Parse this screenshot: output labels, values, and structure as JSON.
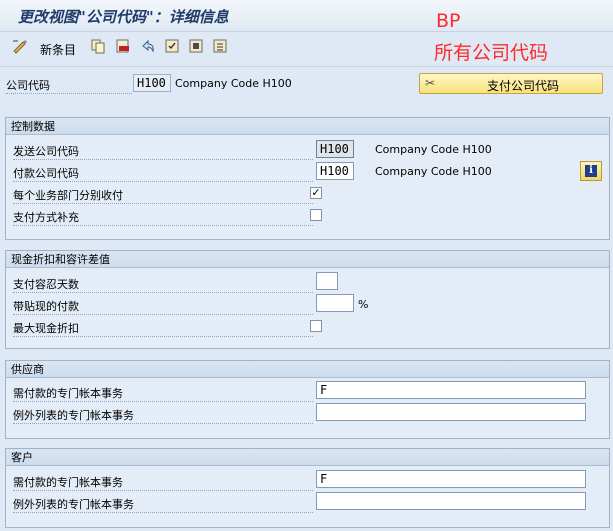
{
  "window": {
    "title": "更改视图\"公司代码\"：详细信息"
  },
  "annotation": {
    "line1": "BP",
    "line2": "所有公司代码"
  },
  "toolbar": {
    "new_entries_label": "新条目"
  },
  "header": {
    "company_code_label": "公司代码",
    "company_code_value": "H100",
    "company_code_name": "Company Code H100",
    "pay_company_button": "支付公司代码"
  },
  "control": {
    "title": "控制数据",
    "sending_cc_label": "发送公司代码",
    "sending_cc_value": "H100",
    "sending_cc_name": "Company Code H100",
    "paying_cc_label": "付款公司代码",
    "paying_cc_value": "H100",
    "paying_cc_name": "Company Code H100",
    "separate_payment_label": "每个业务部门分别收付",
    "separate_payment_checked": true,
    "payment_method_suppl_label": "支付方式补充",
    "payment_method_suppl_checked": false
  },
  "cash": {
    "title": "现金折扣和容许差值",
    "grace_days_label": "支付容忍天数",
    "grace_days_value": "",
    "discounted_payments_label": "带贴现的付款",
    "discounted_payments_value": "",
    "percent_sign": "%",
    "max_discount_label": "最大现金折扣",
    "max_discount_checked": false
  },
  "vendor": {
    "title": "供应商",
    "sgl_to_pay_label": "需付款的专门帐本事务",
    "sgl_to_pay_value": "F",
    "sgl_exception_label": "例外列表的专门帐本事务",
    "sgl_exception_value": ""
  },
  "customer": {
    "title": "客户",
    "sgl_to_pay_label": "需付款的专门帐本事务",
    "sgl_to_pay_value": "F",
    "sgl_exception_label": "例外列表的专门帐本事务",
    "sgl_exception_value": ""
  }
}
